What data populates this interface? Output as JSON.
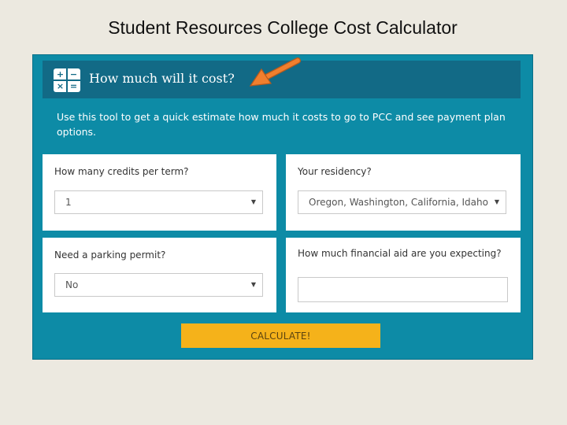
{
  "slide": {
    "title": "Student Resources College Cost Calculator"
  },
  "header": {
    "title": "How much will it cost?",
    "icon": "calculator-icon",
    "icon_symbols": [
      "+",
      "−",
      "×",
      "="
    ],
    "annotation_icon": "orange-arrow-icon"
  },
  "intro": "Use this tool to get a quick estimate how much it costs to go to PCC and see payment plan options.",
  "fields": {
    "credits": {
      "label": "How many credits per term?",
      "value": "1"
    },
    "residency": {
      "label": "Your residency?",
      "value": "Oregon, Washington, California, Idaho"
    },
    "parking": {
      "label": "Need a parking permit?",
      "value": "No"
    },
    "aid": {
      "label": "How much financial aid are you expecting?",
      "value": ""
    }
  },
  "button": {
    "label": "CALCULATE!"
  },
  "colors": {
    "frame": "#0d8ba6",
    "header": "#126a86",
    "button": "#f5b21a",
    "arrow": "#f07f2e",
    "slide_bg": "#ece9e0"
  }
}
